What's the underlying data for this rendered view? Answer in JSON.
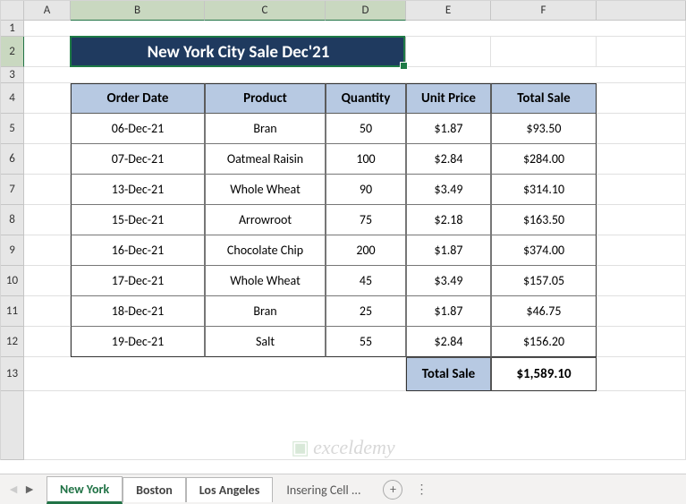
{
  "columns": [
    "A",
    "B",
    "C",
    "D",
    "E",
    "F"
  ],
  "rows": [
    "1",
    "2",
    "3",
    "4",
    "5",
    "6",
    "7",
    "8",
    "9",
    "10",
    "11",
    "12",
    "13"
  ],
  "title": "New York City Sale Dec'21",
  "headers": [
    "Order Date",
    "Product",
    "Quantity",
    "Unit Price",
    "Total Sale"
  ],
  "data": [
    {
      "date": "06-Dec-21",
      "product": "Bran",
      "qty": "50",
      "price": "$1.87",
      "total": "$93.50"
    },
    {
      "date": "07-Dec-21",
      "product": "Oatmeal Raisin",
      "qty": "100",
      "price": "$2.84",
      "total": "$284.00"
    },
    {
      "date": "13-Dec-21",
      "product": "Whole Wheat",
      "qty": "90",
      "price": "$3.49",
      "total": "$314.10"
    },
    {
      "date": "15-Dec-21",
      "product": "Arrowroot",
      "qty": "75",
      "price": "$2.18",
      "total": "$163.50"
    },
    {
      "date": "16-Dec-21",
      "product": "Chocolate Chip",
      "qty": "200",
      "price": "$1.87",
      "total": "$374.00"
    },
    {
      "date": "17-Dec-21",
      "product": "Whole Wheat",
      "qty": "45",
      "price": "$3.49",
      "total": "$157.05"
    },
    {
      "date": "18-Dec-21",
      "product": "Bran",
      "qty": "25",
      "price": "$1.87",
      "total": "$46.75"
    },
    {
      "date": "19-Dec-21",
      "product": "Salt",
      "qty": "55",
      "price": "$2.84",
      "total": "$156.20"
    }
  ],
  "total_label": "Total Sale",
  "total_value": "$1,589.10",
  "tabs": {
    "active": "New York",
    "t1": "Boston",
    "t2": "Los Angeles",
    "t3": "Insering Cell ..."
  },
  "watermark": "exceldemy",
  "chart_data": {
    "type": "table",
    "title": "New York City Sale Dec'21",
    "columns": [
      "Order Date",
      "Product",
      "Quantity",
      "Unit Price",
      "Total Sale"
    ],
    "rows": [
      [
        "06-Dec-21",
        "Bran",
        50,
        1.87,
        93.5
      ],
      [
        "07-Dec-21",
        "Oatmeal Raisin",
        100,
        2.84,
        284.0
      ],
      [
        "13-Dec-21",
        "Whole Wheat",
        90,
        3.49,
        314.1
      ],
      [
        "15-Dec-21",
        "Arrowroot",
        75,
        2.18,
        163.5
      ],
      [
        "16-Dec-21",
        "Chocolate Chip",
        200,
        1.87,
        374.0
      ],
      [
        "17-Dec-21",
        "Whole Wheat",
        45,
        3.49,
        157.05
      ],
      [
        "18-Dec-21",
        "Bran",
        25,
        1.87,
        46.75
      ],
      [
        "19-Dec-21",
        "Salt",
        55,
        2.84,
        156.2
      ]
    ],
    "total": 1589.1
  }
}
